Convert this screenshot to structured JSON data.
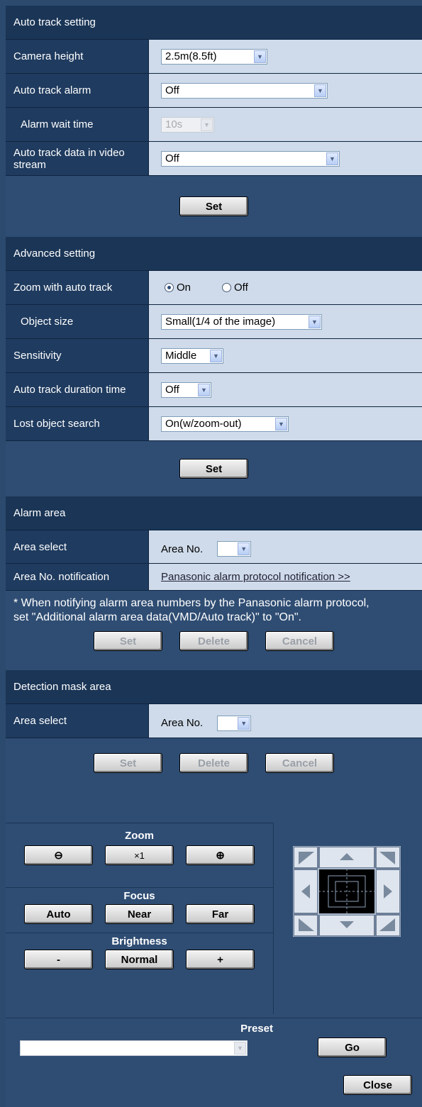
{
  "auto_track": {
    "header": "Auto track setting",
    "camera_height": {
      "label": "Camera height",
      "value": "2.5m(8.5ft)"
    },
    "alarm": {
      "label": "Auto track alarm",
      "value": "Off"
    },
    "alarm_wait": {
      "label": "Alarm wait time",
      "value": "10s"
    },
    "data_in_stream": {
      "label": "Auto track data in video stream",
      "value": "Off"
    },
    "set_label": "Set"
  },
  "advanced": {
    "header": "Advanced setting",
    "zoom": {
      "label": "Zoom with auto track",
      "on_label": "On",
      "off_label": "Off",
      "selected": "On"
    },
    "object_size": {
      "label": "Object size",
      "value": "Small(1/4 of the image)"
    },
    "sensitivity": {
      "label": "Sensitivity",
      "value": "Middle"
    },
    "duration": {
      "label": "Auto track duration time",
      "value": "Off"
    },
    "lost_search": {
      "label": "Lost object search",
      "value": "On(w/zoom-out)"
    },
    "set_label": "Set"
  },
  "alarm_area": {
    "header": "Alarm area",
    "area_select_label": "Area select",
    "area_no_label": "Area No.",
    "notification_label": "Area No. notification",
    "notification_link": "Panasonic alarm protocol notification >>",
    "note_line1": "* When notifying alarm area numbers by the Panasonic alarm protocol,",
    "note_line2": "set \"Additional alarm area data(VMD/Auto track)\" to \"On\".",
    "set_label": "Set",
    "delete_label": "Delete",
    "cancel_label": "Cancel"
  },
  "mask_area": {
    "header": "Detection mask area",
    "area_select_label": "Area select",
    "area_no_label": "Area No.",
    "set_label": "Set",
    "delete_label": "Delete",
    "cancel_label": "Cancel"
  },
  "controls": {
    "zoom_title": "Zoom",
    "zoom_x1": "×1",
    "focus_title": "Focus",
    "focus_auto": "Auto",
    "focus_near": "Near",
    "focus_far": "Far",
    "brightness_title": "Brightness",
    "brightness_minus": "-",
    "brightness_normal": "Normal",
    "brightness_plus": "+"
  },
  "preset": {
    "title": "Preset",
    "value": "",
    "go_label": "Go"
  },
  "close_label": "Close",
  "colors": {
    "panel": "#2f4d73",
    "header": "#1a3556",
    "label_cell": "#1f3b5f",
    "value_cell": "#cfdbea"
  }
}
